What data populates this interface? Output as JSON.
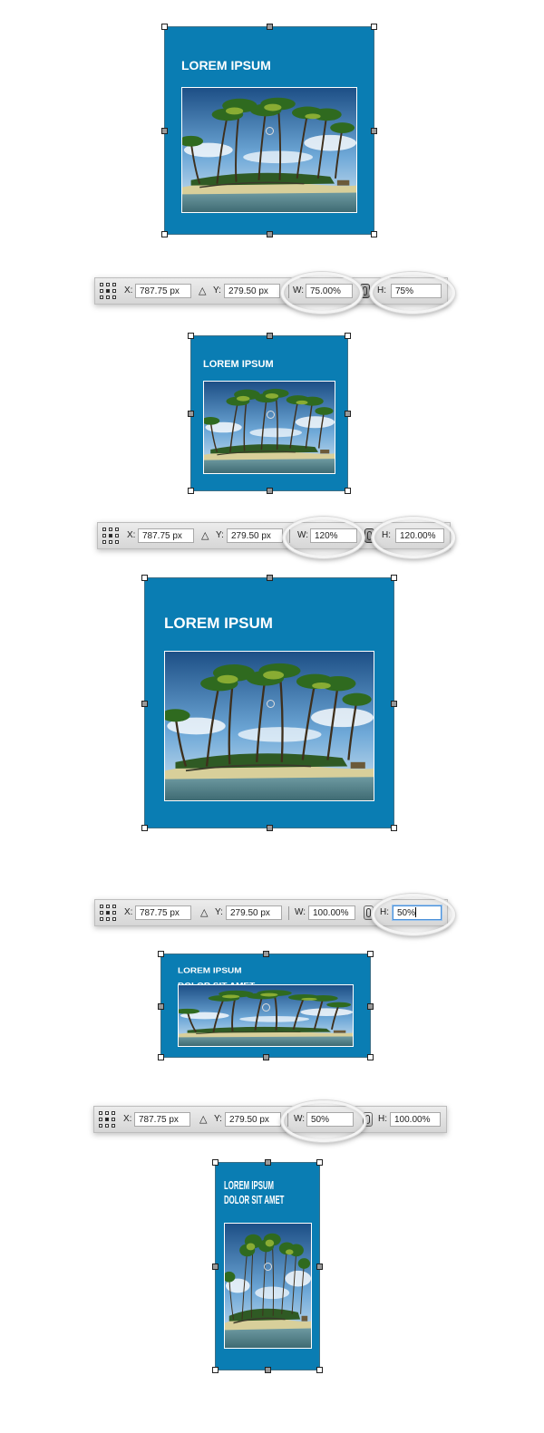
{
  "card": {
    "title_line1": "LOREM IPSUM",
    "title_line2": "DOLOR SIT AMET",
    "background": "#0a7db3"
  },
  "toolbars": [
    {
      "x_label": "X:",
      "x_value": "787.75 px",
      "y_label": "Y:",
      "y_value": "279.50 px",
      "w_label": "W:",
      "w_value": "75.00%",
      "h_label": "H:",
      "h_value": "75%",
      "link_active": true
    },
    {
      "x_label": "X:",
      "x_value": "787.75 px",
      "y_label": "Y:",
      "y_value": "279.50 px",
      "w_label": "W:",
      "w_value": "120%",
      "h_label": "H:",
      "h_value": "120.00%",
      "link_active": true
    },
    {
      "x_label": "X:",
      "x_value": "787.75 px",
      "y_label": "Y:",
      "y_value": "279.50 px",
      "w_label": "W:",
      "w_value": "100.00%",
      "h_label": "H:",
      "h_value": "50%",
      "link_active": false
    },
    {
      "x_label": "X:",
      "x_value": "787.75 px",
      "y_label": "Y:",
      "y_value": "279.50 px",
      "w_label": "W:",
      "w_value": "50%",
      "h_label": "H:",
      "h_value": "100.00%",
      "link_active": false
    }
  ],
  "icons": {
    "reference_point": "reference-point-grid-icon",
    "delta": "delta-icon",
    "link": "chain-link-icon",
    "photo": "tropical-island-photo"
  }
}
